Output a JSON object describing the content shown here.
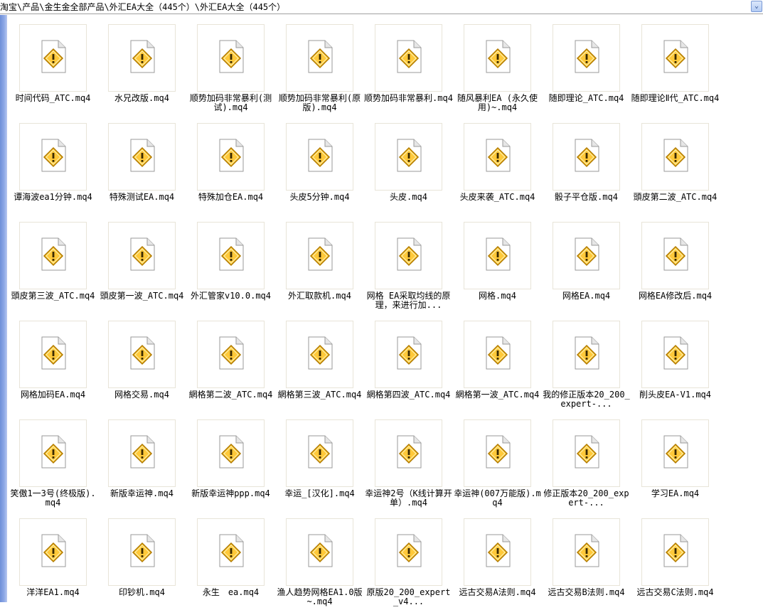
{
  "address_bar": {
    "path": "淘宝\\产品\\金生金全部产品\\外汇EA大全（445个）\\外汇EA大全（445个）",
    "dropdown_glyph": "⌄"
  },
  "files": [
    {
      "name": "时间代码_ATC.mq4",
      "icon": "warning-file-icon"
    },
    {
      "name": "水兄改版.mq4",
      "icon": "warning-file-icon"
    },
    {
      "name": "顺势加码非常暴利(测试).mq4",
      "icon": "warning-file-icon"
    },
    {
      "name": "顺势加码非常暴利(原版).mq4",
      "icon": "warning-file-icon"
    },
    {
      "name": "顺势加码非常暴利.mq4",
      "icon": "warning-file-icon"
    },
    {
      "name": "随风暴利EA (永久使用)~.mq4",
      "icon": "warning-file-icon"
    },
    {
      "name": "随即理论_ATC.mq4",
      "icon": "warning-file-icon"
    },
    {
      "name": "随即理论Ⅱ代_ATC.mq4",
      "icon": "warning-file-icon"
    },
    {
      "name": "谭海波ea1分钟.mq4",
      "icon": "warning-file-icon"
    },
    {
      "name": "特殊测试EA.mq4",
      "icon": "warning-file-icon"
    },
    {
      "name": "特殊加仓EA.mq4",
      "icon": "warning-file-icon"
    },
    {
      "name": "头皮5分钟.mq4",
      "icon": "warning-file-icon"
    },
    {
      "name": "头皮.mq4",
      "icon": "warning-file-icon"
    },
    {
      "name": "头皮来袭_ATC.mq4",
      "icon": "warning-file-icon"
    },
    {
      "name": "骰子平仓版.mq4",
      "icon": "warning-file-icon"
    },
    {
      "name": "頭皮第二波_ATC.mq4",
      "icon": "warning-file-icon"
    },
    {
      "name": "頭皮第三波_ATC.mq4",
      "icon": "warning-file-icon"
    },
    {
      "name": "頭皮第一波_ATC.mq4",
      "icon": "warning-file-icon"
    },
    {
      "name": "外汇管家v10.0.mq4",
      "icon": "warning-file-icon"
    },
    {
      "name": "外汇取款机.mq4",
      "icon": "warning-file-icon"
    },
    {
      "name": "网格 EA采取均线的原理，来进行加...",
      "icon": "warning-file-icon"
    },
    {
      "name": "网格.mq4",
      "icon": "warning-file-icon"
    },
    {
      "name": "网格EA.mq4",
      "icon": "warning-file-icon"
    },
    {
      "name": "网格EA修改后.mq4",
      "icon": "warning-file-icon"
    },
    {
      "name": "网格加码EA.mq4",
      "icon": "warning-file-icon"
    },
    {
      "name": "网格交易.mq4",
      "icon": "warning-file-icon"
    },
    {
      "name": "網格第二波_ATC.mq4",
      "icon": "warning-file-icon"
    },
    {
      "name": "網格第三波_ATC.mq4",
      "icon": "warning-file-icon"
    },
    {
      "name": "網格第四波_ATC.mq4",
      "icon": "warning-file-icon"
    },
    {
      "name": "網格第一波_ATC.mq4",
      "icon": "warning-file-icon"
    },
    {
      "name": "我的修正版本20_200_expert-...",
      "icon": "warning-file-icon"
    },
    {
      "name": "削头皮EA-V1.mq4",
      "icon": "warning-file-icon"
    },
    {
      "name": "笑傲1一3号(终极版).mq4",
      "icon": "warning-file-icon"
    },
    {
      "name": "新版幸运神.mq4",
      "icon": "warning-file-icon"
    },
    {
      "name": "新版幸运神ppp.mq4",
      "icon": "warning-file-icon"
    },
    {
      "name": "幸运_[汉化].mq4",
      "icon": "warning-file-icon"
    },
    {
      "name": "幸运神2号（K线计算开单）.mq4",
      "icon": "warning-file-icon"
    },
    {
      "name": "幸运神(007万能版).mq4",
      "icon": "warning-file-icon"
    },
    {
      "name": "修正版本20_200_expert-...",
      "icon": "warning-file-icon"
    },
    {
      "name": "学习EA.mq4",
      "icon": "warning-file-icon"
    },
    {
      "name": "洋洋EA1.mq4",
      "icon": "warning-file-icon"
    },
    {
      "name": "印钞机.mq4",
      "icon": "warning-file-icon"
    },
    {
      "name": "永生　ea.mq4",
      "icon": "warning-file-icon"
    },
    {
      "name": "渔人趋势网格EA1.0版~.mq4",
      "icon": "warning-file-icon"
    },
    {
      "name": "原版20_200_expert_v4...",
      "icon": "warning-file-icon"
    },
    {
      "name": "远古交易A法则.mq4",
      "icon": "warning-file-icon"
    },
    {
      "name": "远古交易B法则.mq4",
      "icon": "warning-file-icon"
    },
    {
      "name": "远古交易C法则.mq4",
      "icon": "warning-file-icon"
    }
  ]
}
